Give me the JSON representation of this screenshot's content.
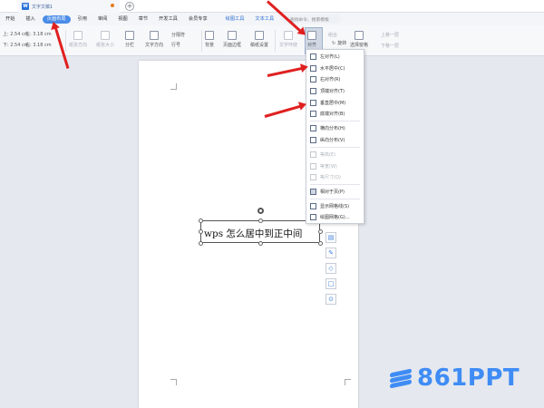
{
  "window": {
    "doc_tab_title": "文字文稿1",
    "app_icon": "W",
    "new_tab_symbol": "+"
  },
  "ribbon": {
    "tabs": [
      "开始",
      "插入",
      "页面布局",
      "引用",
      "审阅",
      "视图",
      "章节",
      "开发工具",
      "会员专享",
      "绘图工具",
      "文本工具"
    ],
    "active_tab": "页面布局",
    "search_placeholder": "查找命令、搜索模板"
  },
  "toolbar": {
    "margin_top": "2.54 cm",
    "margin_bottom": "2.54 cm",
    "margin_left": "3.18 cm",
    "margin_right": "3.18 cm",
    "paper_direction": "纸张方向",
    "paper_size": "纸张大小",
    "columns": "分栏",
    "text_direction": "文字方向",
    "separator": "分隔符",
    "line_number": "行号",
    "background": "背景",
    "page_border": "页面边框",
    "draft_settings": "稿纸设置",
    "text_wrap": "文字环绕",
    "align": "对齐",
    "rotate": "旋转",
    "selection_pane": "选择窗格",
    "move_up": "上移一层",
    "move_down": "下移一层",
    "combine": "组合"
  },
  "align_menu": {
    "items": [
      {
        "label": "左对齐(L)",
        "disabled": false
      },
      {
        "label": "水平居中(C)",
        "disabled": false
      },
      {
        "label": "右对齐(R)",
        "disabled": false
      },
      {
        "label": "顶端对齐(T)",
        "disabled": false
      },
      {
        "label": "垂直居中(M)",
        "disabled": false
      },
      {
        "label": "底端对齐(B)",
        "disabled": false
      },
      {
        "label": "横向分布(H)",
        "disabled": false
      },
      {
        "label": "纵向分布(V)",
        "disabled": false
      },
      {
        "label": "等高(E)",
        "disabled": true
      },
      {
        "label": "等宽(W)",
        "disabled": true
      },
      {
        "label": "等尺寸(Q)",
        "disabled": true
      },
      {
        "label": "相对于页(P)",
        "disabled": false,
        "checked": true
      },
      {
        "label": "显示网格线(S)",
        "disabled": false
      },
      {
        "label": "绘图网格(G)...",
        "disabled": false
      }
    ]
  },
  "document": {
    "textbox_text": "wps 怎么居中到正中间"
  },
  "watermark": {
    "text": "861PPT",
    "color": "#3f8cf5"
  },
  "colors": {
    "accent": "#4a8ce8",
    "arrow": "#e02020"
  },
  "icons": [
    "app-icon",
    "search-icon",
    "paper-direction-icon",
    "paper-size-icon",
    "columns-icon",
    "text-direction-icon",
    "background-icon",
    "page-border-icon",
    "draft-icon",
    "wrap-icon",
    "align-icon",
    "rotate-icon",
    "selection-pane-icon",
    "rotate-handle-icon",
    "layout-options-icon",
    "edit-pen-icon",
    "fill-icon",
    "outline-icon",
    "location-icon"
  ]
}
